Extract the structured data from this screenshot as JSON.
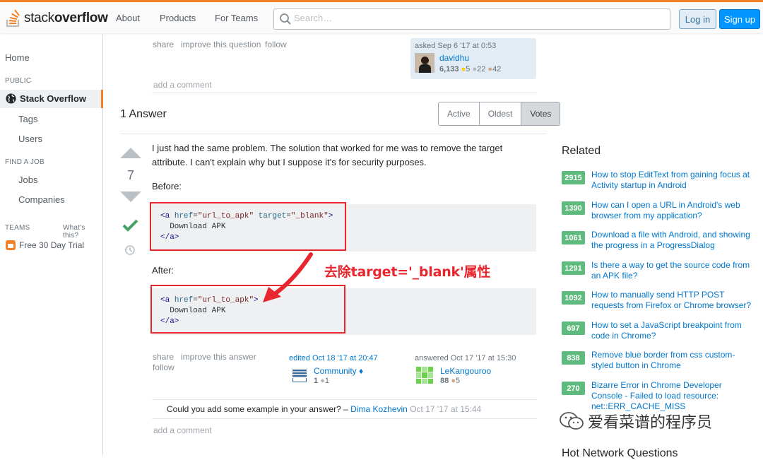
{
  "header": {
    "logo_text_light": "stack",
    "logo_text_bold": "overflow",
    "nav": [
      "About",
      "Products",
      "For Teams"
    ],
    "search_placeholder": "Search…",
    "login": "Log in",
    "signup": "Sign up",
    "accent": "#f48024"
  },
  "sidebar": {
    "home": "Home",
    "public_heading": "PUBLIC",
    "stack_overflow": "Stack Overflow",
    "tags": "Tags",
    "users": "Users",
    "find_job_heading": "FIND A JOB",
    "jobs": "Jobs",
    "companies": "Companies",
    "teams_heading": "TEAMS",
    "whats_this": "What's this?",
    "free_trial": "Free 30 Day Trial"
  },
  "question_footer": {
    "share": "share",
    "improve": "improve this question",
    "follow": "follow",
    "asked": "asked Sep 6 '17 at 0:53",
    "user": "davidhu",
    "rep": "6,133",
    "gold": "5",
    "silver": "22",
    "bronze": "42",
    "add_comment": "add a comment"
  },
  "answers": {
    "count_label": "1 Answer",
    "sort_tabs": [
      "Active",
      "Oldest",
      "Votes"
    ]
  },
  "answer": {
    "votes": "7",
    "body_line1": "I just had the same problem. The solution that worked for me was to remove the target",
    "body_line2": "attribute. I can't explain why but I suppose it's for security purposes.",
    "before_label": "Before:",
    "after_label": "After:",
    "code_before": {
      "open": "<",
      "tag": "a",
      "attr1": "href",
      "val1": "\"url_to_apk\"",
      "attr2": "target",
      "val2": "\"_blank\"",
      "close": ">",
      "text": "Download APK",
      "end": "</a>"
    },
    "code_after": {
      "attr1": "href",
      "val1": "\"url_to_apk\"",
      "text": "Download APK",
      "end": "</a>"
    },
    "annotation": "去除target='_blank'属性",
    "share": "share",
    "improve": "improve this answer",
    "follow": "follow",
    "edited": "edited Oct 18 '17 at 20:47",
    "editor": "Community ♦",
    "editor_rep": "1",
    "editor_silver": "1",
    "answered": "answered Oct 17 '17 at 15:30",
    "answerer": "LeKangouroo",
    "answerer_rep": "88",
    "answerer_bronze": "5",
    "comment_text": "Could you add some example in your answer? – ",
    "comment_user": "Dima Kozhevin",
    "comment_time": "Oct 17 '17 at 15:44",
    "add_comment": "add a comment"
  },
  "related": {
    "title": "Related",
    "items": [
      {
        "score": "2915",
        "title": "How to stop EditText from gaining focus at Activity startup in Android"
      },
      {
        "score": "1390",
        "title": "How can I open a URL in Android's web browser from my application?"
      },
      {
        "score": "1061",
        "title": "Download a file with Android, and showing the progress in a ProgressDialog"
      },
      {
        "score": "1291",
        "title": "Is there a way to get the source code from an APK file?"
      },
      {
        "score": "1092",
        "title": "How to manually send HTTP POST requests from Firefox or Chrome browser?"
      },
      {
        "score": "697",
        "title": "How to set a JavaScript breakpoint from code in Chrome?"
      },
      {
        "score": "838",
        "title": "Remove blue border from css custom-styled button in Chrome"
      },
      {
        "score": "270",
        "title": "Bizarre Error in Chrome Developer Console - Failed to load resource: net::ERR_CACHE_MISS"
      }
    ],
    "hot_title": "Hot Network Questions"
  },
  "watermark": "爱看菜谱的程序员"
}
